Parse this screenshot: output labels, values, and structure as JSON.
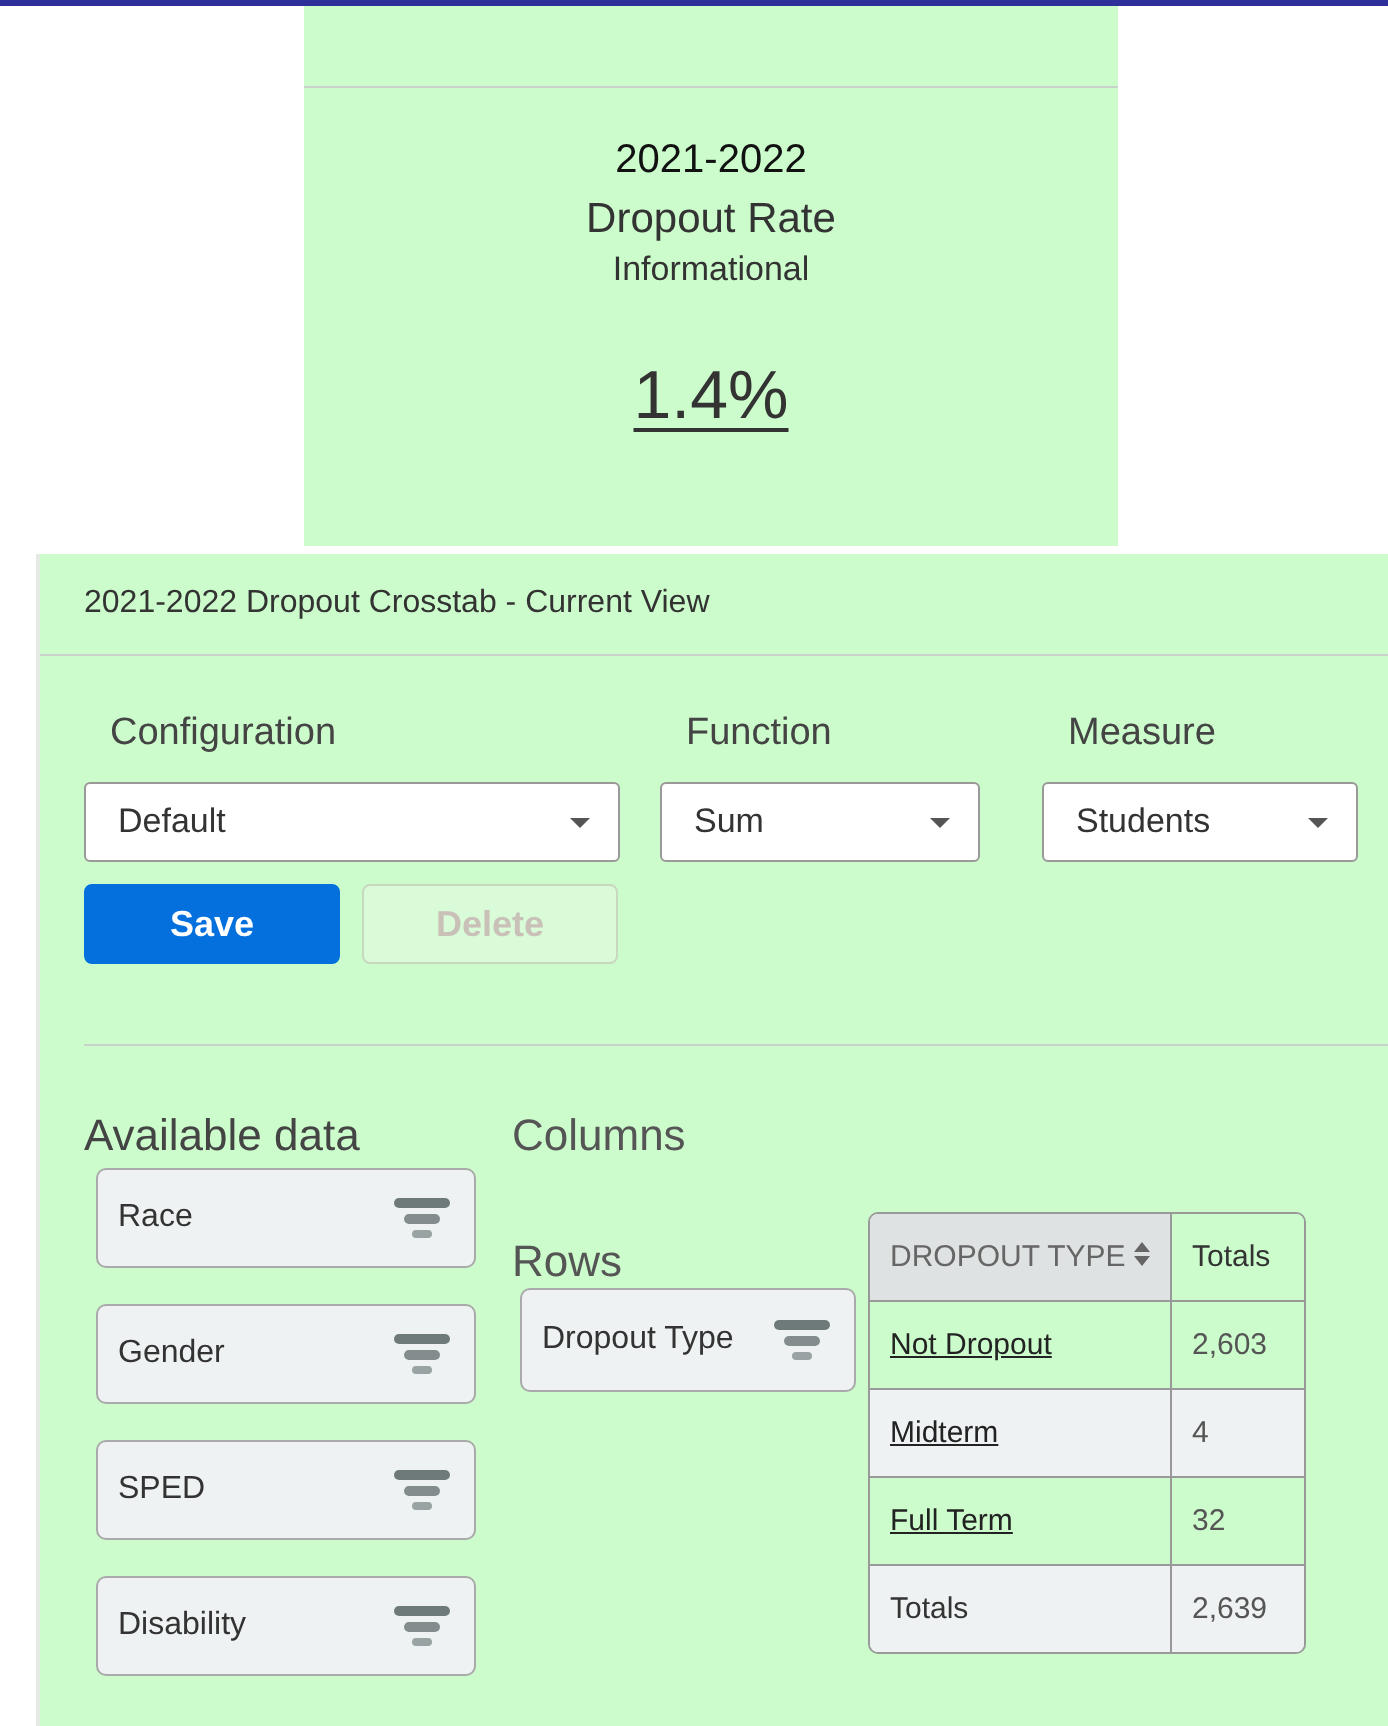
{
  "summary_card": {
    "year": "2021-2022",
    "title": "Dropout Rate",
    "subtitle": "Informational",
    "value": "1.4%"
  },
  "crosstab": {
    "title": "2021-2022 Dropout Crosstab - Current View",
    "selects": [
      {
        "label": "Configuration",
        "value": "Default"
      },
      {
        "label": "Function",
        "value": "Sum"
      },
      {
        "label": "Measure",
        "value": "Students"
      }
    ],
    "buttons": [
      {
        "label": "Save",
        "disabled": false
      },
      {
        "label": "Delete",
        "disabled": true
      }
    ],
    "available_data": {
      "heading": "Available data",
      "items": [
        "Race",
        "Gender",
        "SPED",
        "Disability"
      ]
    },
    "columns": {
      "heading": "Columns"
    },
    "rows": {
      "heading": "Rows",
      "items": [
        "Dropout Type"
      ]
    },
    "table": {
      "columns": [
        "DROPOUT TYPE",
        "Totals"
      ],
      "rows": [
        {
          "kind": "link",
          "label": "Not Dropout",
          "value": "2,603"
        },
        {
          "kind": "link",
          "label": "Midterm",
          "value": "4"
        },
        {
          "kind": "link",
          "label": "Full Term",
          "value": "32"
        },
        {
          "kind": "total",
          "label": "Totals",
          "value": "2,639"
        }
      ]
    }
  }
}
